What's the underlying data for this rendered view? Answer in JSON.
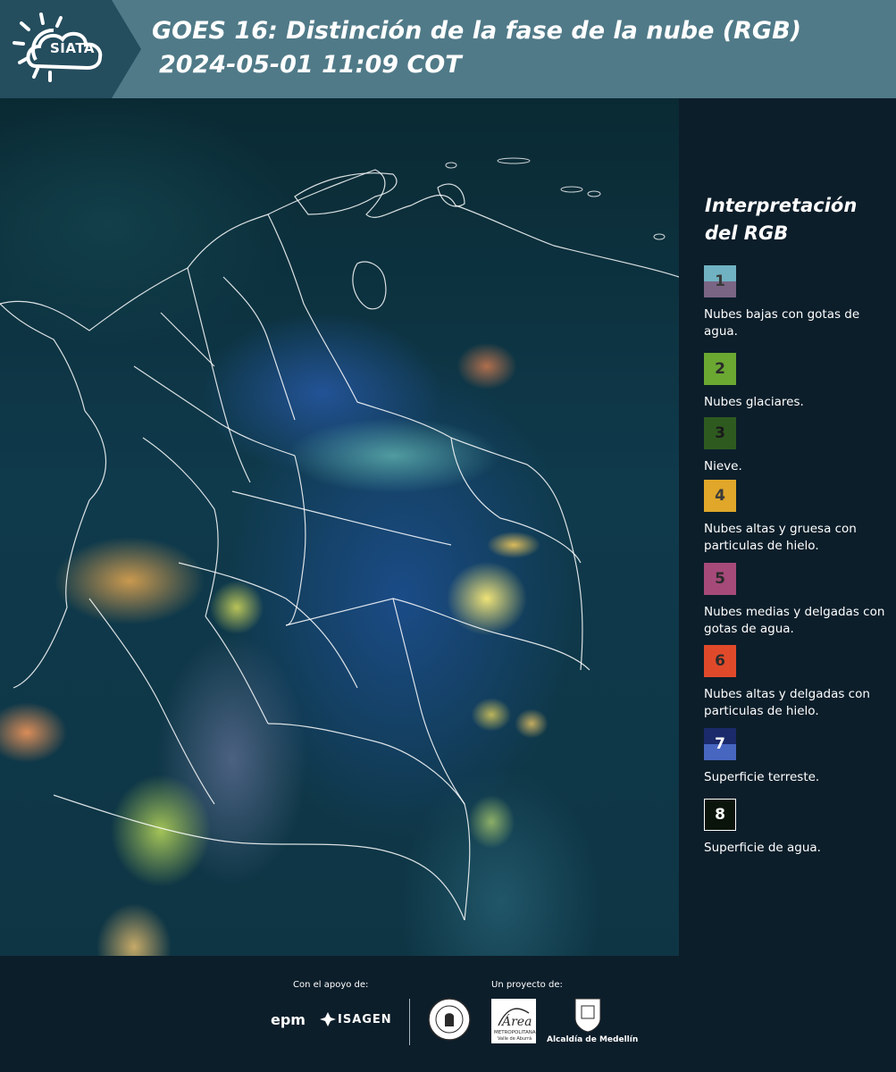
{
  "header": {
    "logo_text": "SIATA",
    "title_line1": "GOES 16: Distinción de la fase de la nube (RGB)",
    "title_line2": "2024-05-01 11:09 COT"
  },
  "legend": {
    "title": "Interpretación del RGB",
    "items": [
      {
        "num": "1",
        "label": "Nubes bajas con gotas de agua.",
        "color_top": "#70b2c2",
        "color_bottom": "#7a6585",
        "num_color": "#3a3a3a"
      },
      {
        "num": "2",
        "label": "Nubes glaciares.",
        "color_top": "#6aa832",
        "color_bottom": "#6aa832",
        "num_color": "#2a2a2a"
      },
      {
        "num": "3",
        "label": "Nieve.",
        "color_top": "#2e5a20",
        "color_bottom": "#2e5a20",
        "num_color": "#1a1a1a"
      },
      {
        "num": "4",
        "label": "Nubes altas y gruesa con particulas de hielo.",
        "color_top": "#e0a72a",
        "color_bottom": "#e0a72a",
        "num_color": "#3a3a3a"
      },
      {
        "num": "5",
        "label": "Nubes medias y delgadas con gotas de agua.",
        "color_top": "#a64a7a",
        "color_bottom": "#a64a7a",
        "num_color": "#2a2a2a"
      },
      {
        "num": "6",
        "label": "Nubes altas y delgadas con particulas de hielo.",
        "color_top": "#e04a2a",
        "color_bottom": "#e04a2a",
        "num_color": "#2a2a2a"
      },
      {
        "num": "7",
        "label": "Superficie terreste.",
        "color_top": "#1b2a6a",
        "color_bottom": "#4766c0",
        "num_color": "#ffffff"
      },
      {
        "num": "8",
        "label": "Superficie de agua.",
        "color_top": "#0a140a",
        "color_bottom": "#0a140a",
        "num_color": "#ffffff"
      }
    ]
  },
  "footer": {
    "support_label": "Con el apoyo de:",
    "project_label": "Un proyecto de:",
    "sponsor_epm": "epm",
    "sponsor_isagen": "ISAGEN",
    "area_metro_title": "Área",
    "area_metro_sub1": "METROPOLITANA",
    "area_metro_sub2": "Valle de Aburrá",
    "alcaldia": "Alcaldía de Medellín"
  }
}
